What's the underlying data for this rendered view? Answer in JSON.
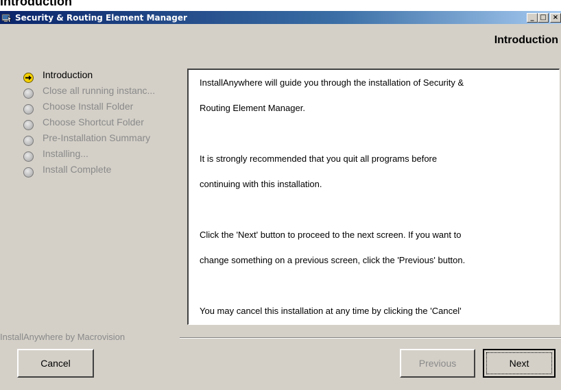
{
  "page": {
    "heading": "Introduction"
  },
  "window": {
    "title": "Security & Routing Element Manager",
    "controls": {
      "minimize": "_",
      "maximize": "□",
      "close": "×"
    }
  },
  "header": {
    "step_title": "Introduction"
  },
  "steps": [
    {
      "label": "Introduction",
      "state": "current"
    },
    {
      "label": "Close all running instanc...",
      "state": "pending"
    },
    {
      "label": "Choose Install Folder",
      "state": "pending"
    },
    {
      "label": "Choose Shortcut Folder",
      "state": "pending"
    },
    {
      "label": "Pre-Installation Summary",
      "state": "pending"
    },
    {
      "label": "Installing...",
      "state": "pending"
    },
    {
      "label": "Install Complete",
      "state": "pending"
    }
  ],
  "content": {
    "p1_line1": "InstallAnywhere will guide you through the installation of Security &",
    "p1_line2": "Routing Element Manager.",
    "p2_line1": "It is strongly recommended that you quit all programs before",
    "p2_line2": "continuing with this installation.",
    "p3_line1": "Click the 'Next' button to proceed to the next screen. If you want to",
    "p3_line2": "change something on a previous screen, click the 'Previous' button.",
    "p4_line1": "You may cancel this installation at any time by clicking the 'Cancel'"
  },
  "footer": {
    "brand": "InstallAnywhere by Macrovision",
    "cancel_label": "Cancel",
    "previous_label": "Previous",
    "next_label": "Next"
  },
  "colors": {
    "titlebar_start": "#0a246a",
    "titlebar_end": "#a6caf0",
    "dialog_bg": "#d4d0c8",
    "disabled_text": "#8a8a8a",
    "current_step_bullet": "#f4d000"
  },
  "icons": {
    "app": "installer-app-icon",
    "current_step": "arrow-right-icon",
    "pending_step": "gray-circle-icon"
  }
}
